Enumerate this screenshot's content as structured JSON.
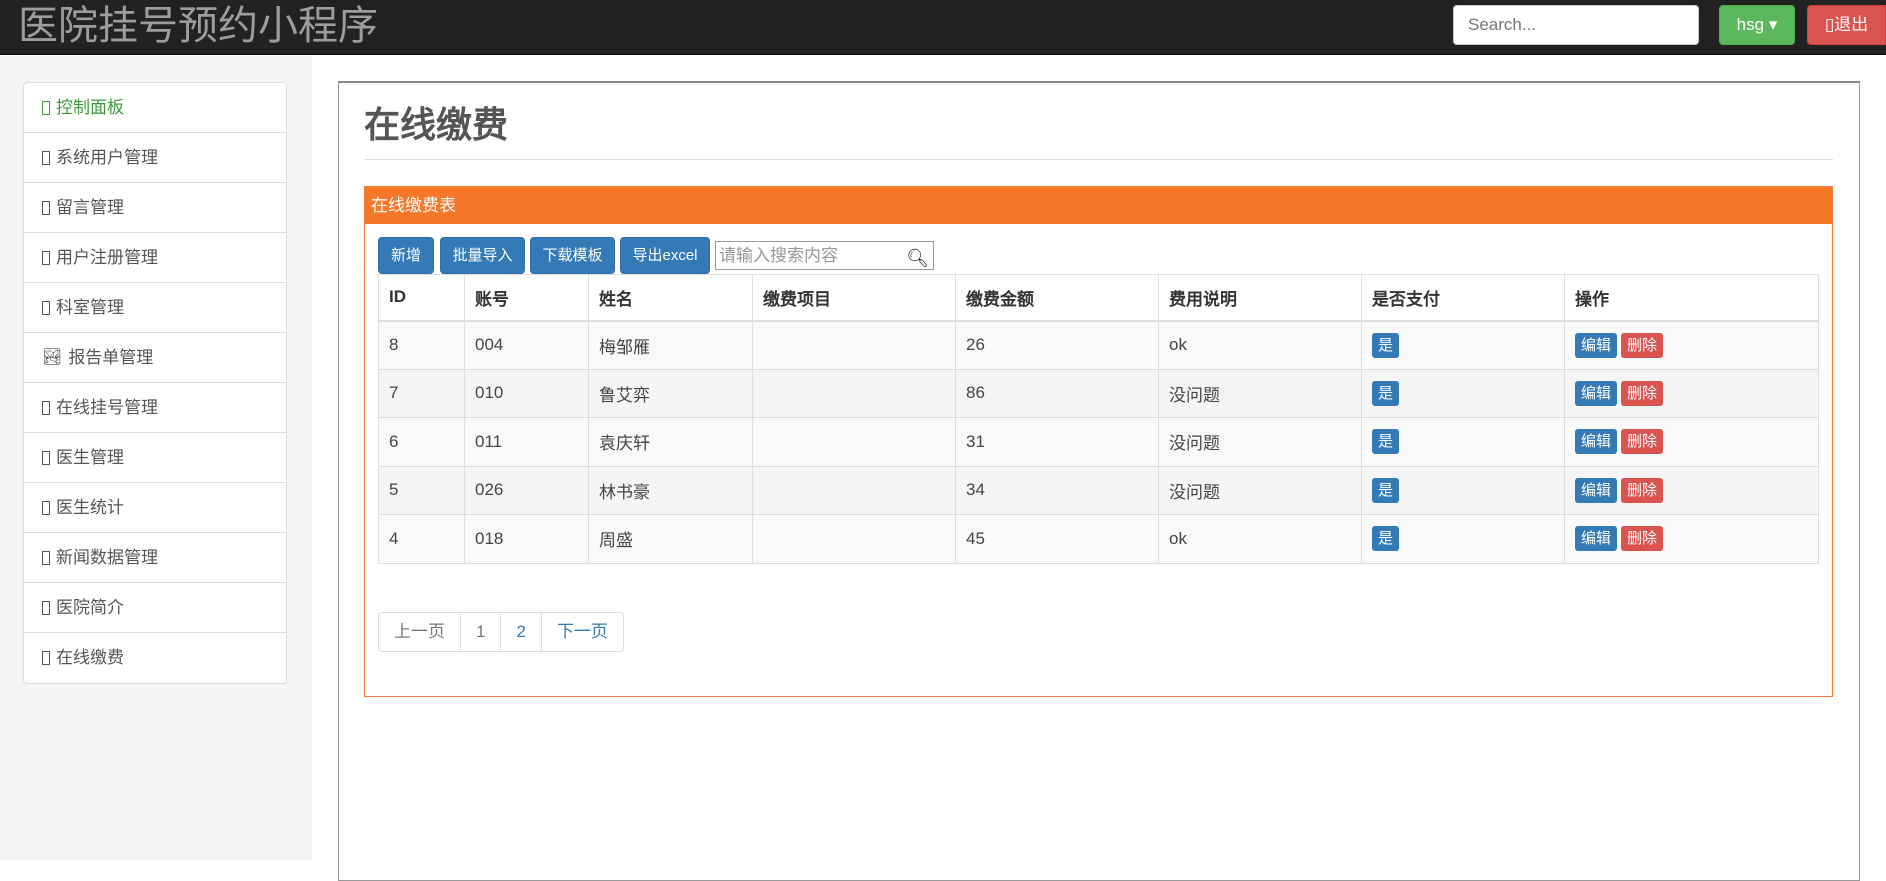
{
  "header": {
    "title": "医院挂号预约小程序",
    "search_placeholder": "Search...",
    "user": "hsg ▾",
    "logout": "▯退出"
  },
  "sidebar": {
    "items": [
      {
        "label": "控制面板",
        "icon": "square-icon"
      },
      {
        "label": "系统用户管理",
        "icon": "square-icon"
      },
      {
        "label": "留言管理",
        "icon": "square-icon"
      },
      {
        "label": "用户注册管理",
        "icon": "square-icon"
      },
      {
        "label": "科室管理",
        "icon": "square-icon"
      },
      {
        "label": "报告单管理",
        "icon": "picture-icon"
      },
      {
        "label": "在线挂号管理",
        "icon": "square-icon"
      },
      {
        "label": "医生管理",
        "icon": "square-icon"
      },
      {
        "label": "医生统计",
        "icon": "square-icon"
      },
      {
        "label": "新闻数据管理",
        "icon": "square-icon"
      },
      {
        "label": "医院简介",
        "icon": "square-icon"
      },
      {
        "label": "在线缴费",
        "icon": "square-icon"
      }
    ]
  },
  "page": {
    "title": "在线缴费",
    "panel_title": "在线缴费表",
    "toolbar": {
      "add": "新增",
      "import": "批量导入",
      "template": "下载模板",
      "export": "导出excel",
      "search_placeholder": "请输入搜索内容"
    },
    "columns": [
      "ID",
      "账号",
      "姓名",
      "缴费项目",
      "缴费金额",
      "费用说明",
      "是否支付",
      "操作"
    ],
    "rows": [
      {
        "id": "8",
        "account": "004",
        "name": "梅邹雁",
        "item": "",
        "amount": "26",
        "note": "ok",
        "paid": "是"
      },
      {
        "id": "7",
        "account": "010",
        "name": "鲁艾弈",
        "item": "",
        "amount": "86",
        "note": "没问题",
        "paid": "是"
      },
      {
        "id": "6",
        "account": "011",
        "name": "袁庆轩",
        "item": "",
        "amount": "31",
        "note": "没问题",
        "paid": "是"
      },
      {
        "id": "5",
        "account": "026",
        "name": "林书豪",
        "item": "",
        "amount": "34",
        "note": "没问题",
        "paid": "是"
      },
      {
        "id": "4",
        "account": "018",
        "name": "周盛",
        "item": "",
        "amount": "45",
        "note": "ok",
        "paid": "是"
      }
    ],
    "actions": {
      "edit": "编辑",
      "delete": "删除"
    },
    "pagination": {
      "prev": "上一页",
      "pages": [
        "1",
        "2"
      ],
      "next": "下一页"
    }
  }
}
